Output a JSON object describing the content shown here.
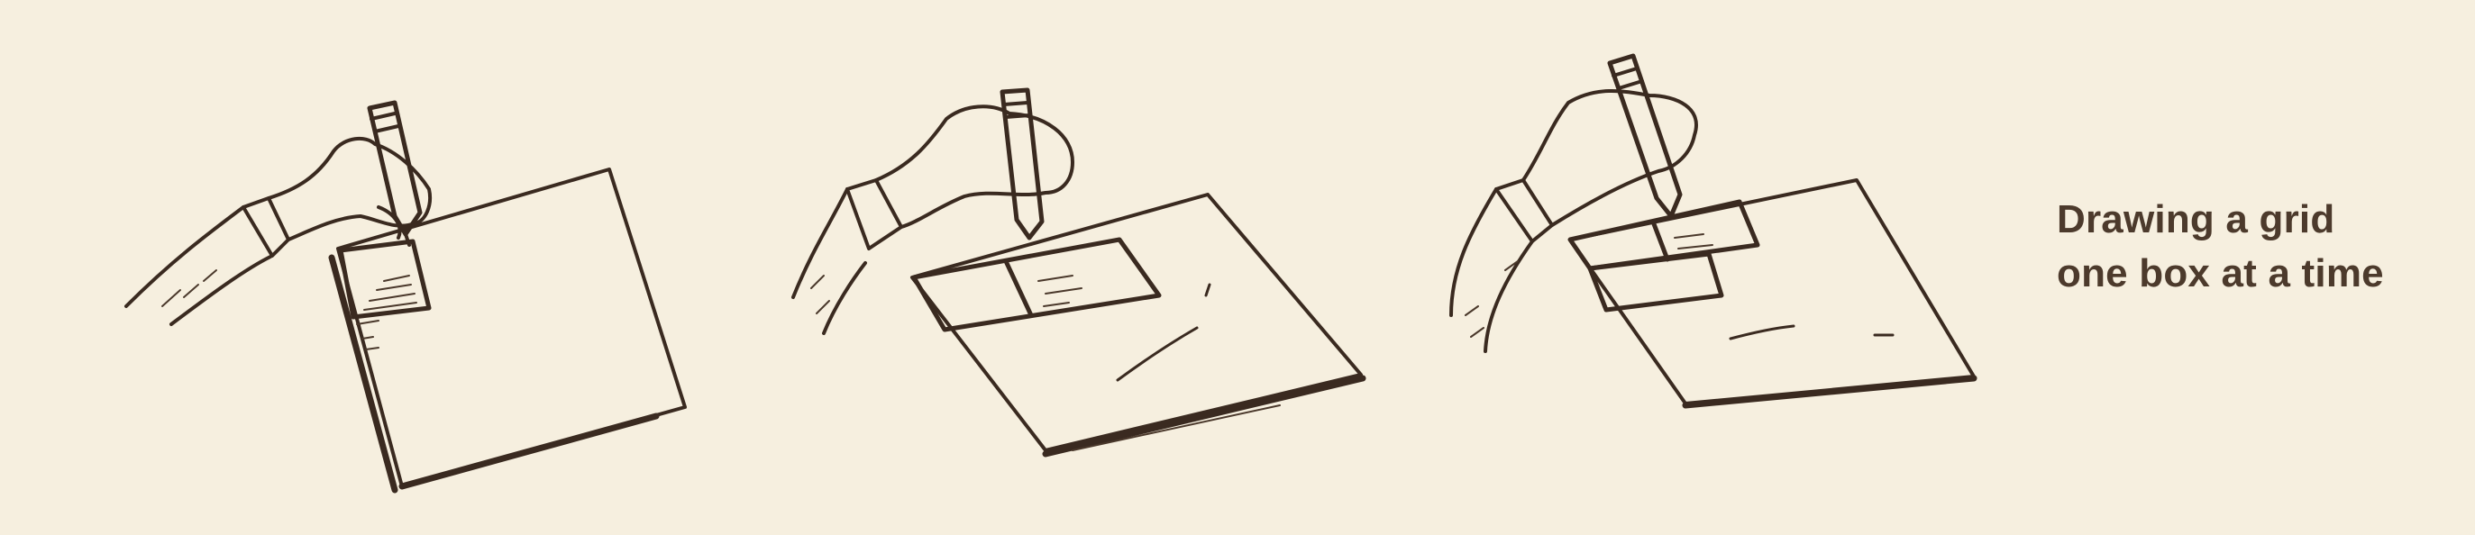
{
  "caption": {
    "line1": "Drawing a grid",
    "line2": "one box at a time"
  },
  "colors": {
    "background": "#f6efdf",
    "ink": "#3a2a20",
    "caption_text": "#4c3a2c"
  },
  "illustrations": [
    {
      "step": 1,
      "description_icon": "hand-drawing-first-box-icon"
    },
    {
      "step": 2,
      "description_icon": "hand-drawing-second-box-icon"
    },
    {
      "step": 3,
      "description_icon": "hand-drawing-third-box-icon"
    }
  ]
}
